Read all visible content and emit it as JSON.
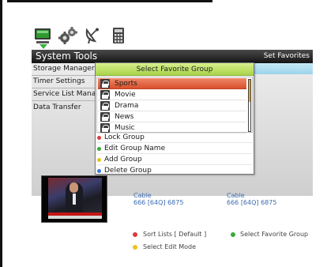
{
  "header": {
    "title": "System Tools",
    "right_label": "Set Favorites"
  },
  "toolbar_icons": [
    "monitor-icon",
    "gears-icon",
    "satellite-dish-icon",
    "calculator-icon"
  ],
  "sidebar": {
    "items": [
      {
        "label": "Storage Manager"
      },
      {
        "label": "Timer Settings"
      },
      {
        "label": "Service List Manage"
      },
      {
        "label": "Data Transfer"
      }
    ]
  },
  "popup": {
    "title": "Select Favorite Group",
    "groups": [
      {
        "name": "Sports",
        "selected": true
      },
      {
        "name": "Movie",
        "selected": false
      },
      {
        "name": "Drama",
        "selected": false
      },
      {
        "name": "News",
        "selected": false
      },
      {
        "name": "Music",
        "selected": false
      }
    ],
    "actions": [
      {
        "label": "Lock Group",
        "color": "#e03a3a"
      },
      {
        "label": "Edit Group Name",
        "color": "#3aaa3a"
      },
      {
        "label": "Add Group",
        "color": "#f0c020"
      },
      {
        "label": "Delete Group",
        "color": "#3a7ad8"
      }
    ]
  },
  "channels": [
    {
      "type": "Cable",
      "info": "666 [64Q] 6875"
    },
    {
      "type": "Cable",
      "info": "666 [64Q] 6875"
    }
  ],
  "footer": {
    "sort_lists": "Sort Lists [ Default ]",
    "select_favorite_group": "Select Favorite Group",
    "select_edit_mode": "Select Edit Mode",
    "colors": {
      "red": "#e03a3a",
      "green": "#3aaa3a",
      "yellow": "#f0c020"
    }
  }
}
